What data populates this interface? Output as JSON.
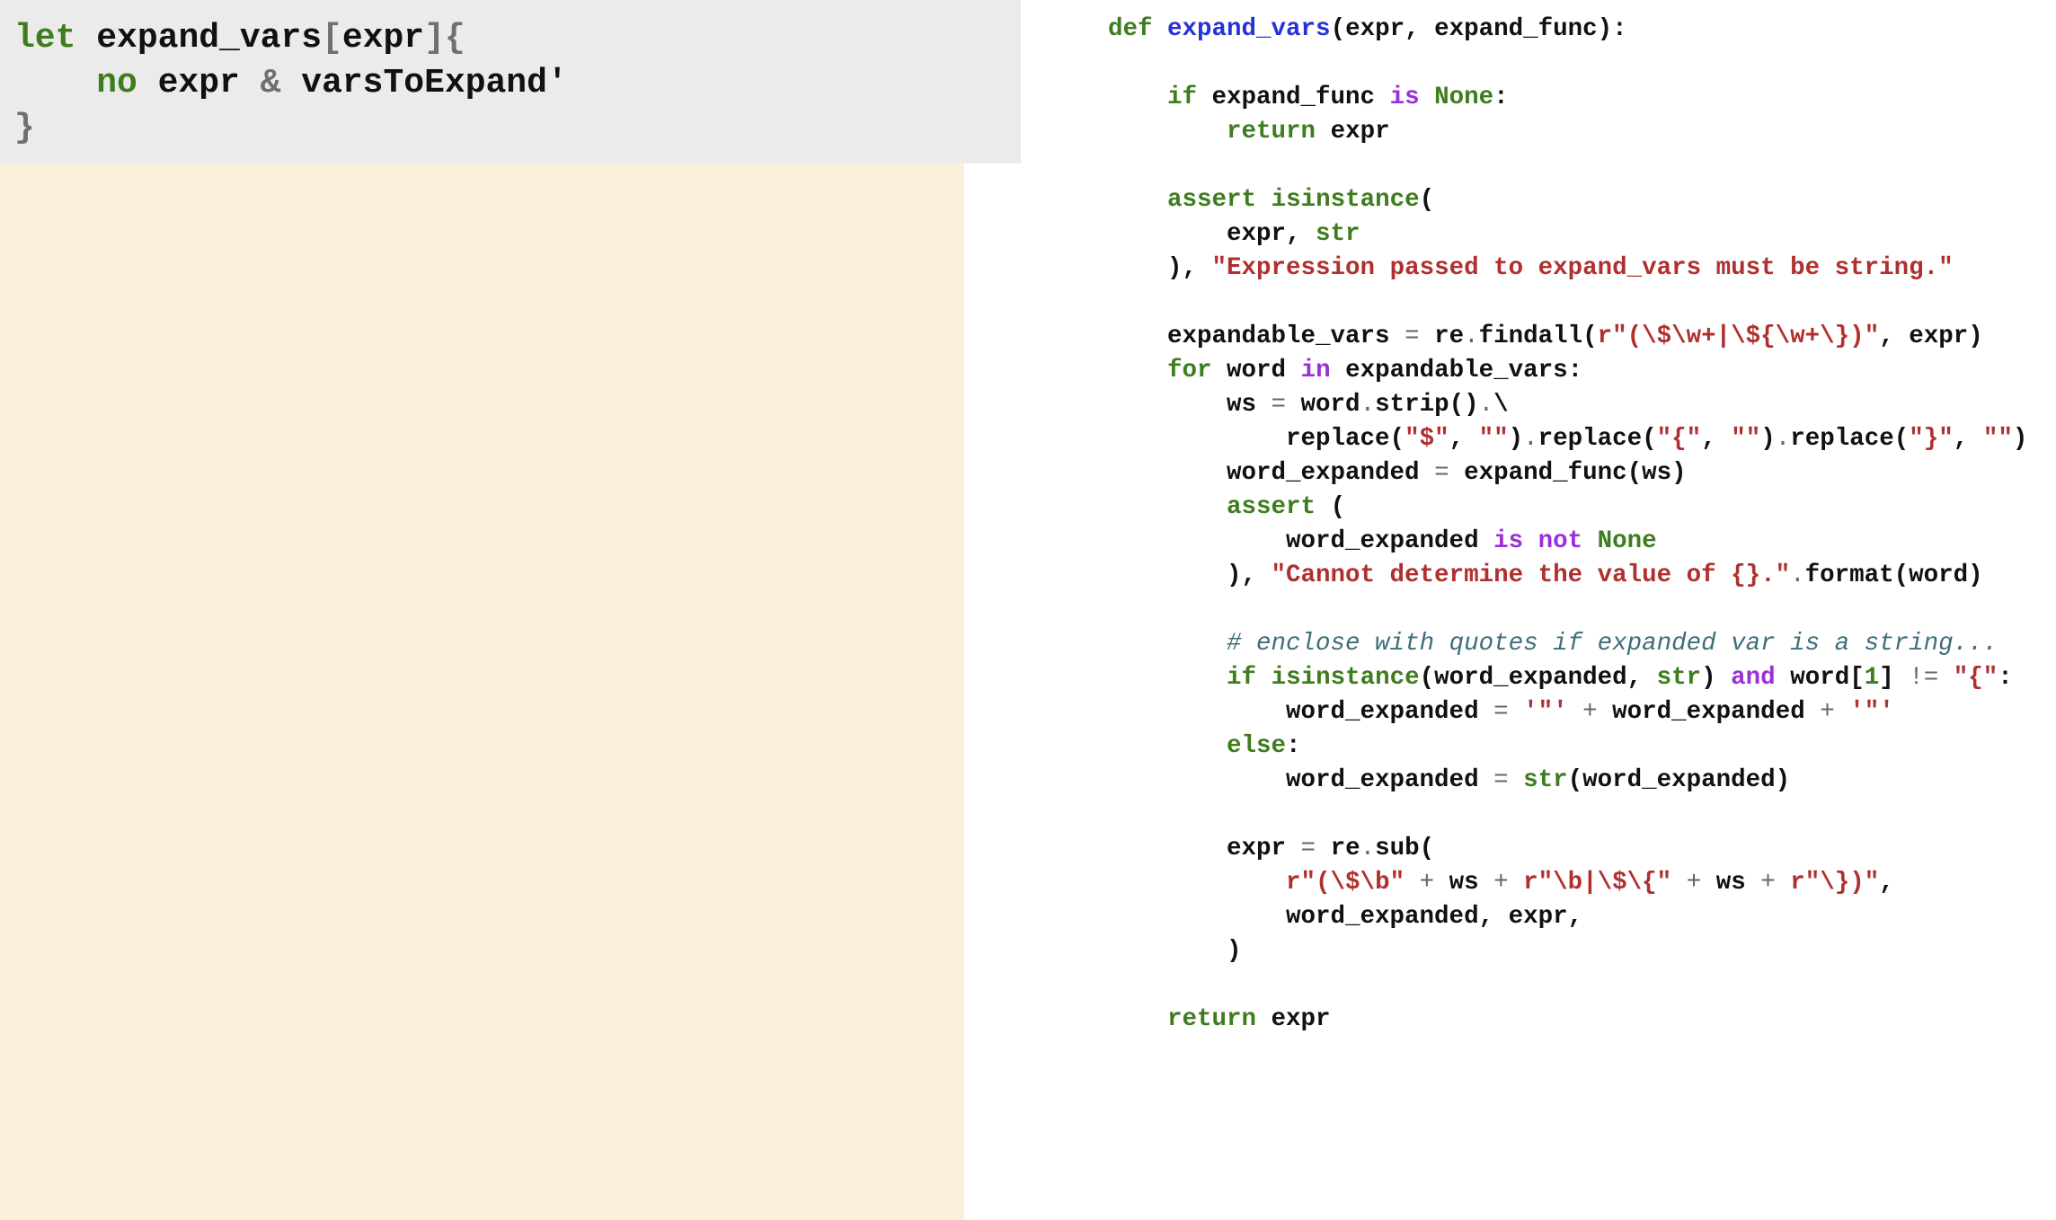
{
  "left_code": {
    "lines": [
      [
        {
          "t": "let",
          "k": "lkw"
        },
        {
          "t": " ",
          "k": "lid"
        },
        {
          "t": "expand_vars",
          "k": "lid"
        },
        {
          "t": "[",
          "k": "lsym"
        },
        {
          "t": "expr",
          "k": "lid"
        },
        {
          "t": "]{",
          "k": "lsym"
        }
      ],
      [
        {
          "t": "    ",
          "k": "lid"
        },
        {
          "t": "no",
          "k": "lkw"
        },
        {
          "t": " expr ",
          "k": "lid"
        },
        {
          "t": "&",
          "k": "lsym"
        },
        {
          "t": " varsToExpand'",
          "k": "lid"
        }
      ],
      [
        {
          "t": "}",
          "k": "lsym"
        }
      ]
    ]
  },
  "right_code": {
    "lines": [
      [
        {
          "t": "def",
          "k": "kw"
        },
        {
          "t": " ",
          "k": "id"
        },
        {
          "t": "expand_vars",
          "k": "def"
        },
        {
          "t": "(expr, expand_func):",
          "k": "id"
        }
      ],
      [],
      [
        {
          "t": "    ",
          "k": "id"
        },
        {
          "t": "if",
          "k": "kw"
        },
        {
          "t": " expand_func ",
          "k": "id"
        },
        {
          "t": "is",
          "k": "op2"
        },
        {
          "t": " ",
          "k": "id"
        },
        {
          "t": "None",
          "k": "kw"
        },
        {
          "t": ":",
          "k": "id"
        }
      ],
      [
        {
          "t": "        ",
          "k": "id"
        },
        {
          "t": "return",
          "k": "kw"
        },
        {
          "t": " expr",
          "k": "id"
        }
      ],
      [],
      [
        {
          "t": "    ",
          "k": "id"
        },
        {
          "t": "assert",
          "k": "kw"
        },
        {
          "t": " ",
          "k": "id"
        },
        {
          "t": "isinstance",
          "k": "kw"
        },
        {
          "t": "(",
          "k": "id"
        }
      ],
      [
        {
          "t": "        expr, ",
          "k": "id"
        },
        {
          "t": "str",
          "k": "kw"
        }
      ],
      [
        {
          "t": "    ), ",
          "k": "id"
        },
        {
          "t": "\"Expression passed to expand_vars must be string.\"",
          "k": "str"
        }
      ],
      [],
      [
        {
          "t": "    expandable_vars ",
          "k": "id"
        },
        {
          "t": "=",
          "k": "sym"
        },
        {
          "t": " re",
          "k": "id"
        },
        {
          "t": ".",
          "k": "sym"
        },
        {
          "t": "findall(",
          "k": "id"
        },
        {
          "t": "r\"(\\$\\w+|\\${\\w+\\})\"",
          "k": "str"
        },
        {
          "t": ", expr)",
          "k": "id"
        }
      ],
      [
        {
          "t": "    ",
          "k": "id"
        },
        {
          "t": "for",
          "k": "kw"
        },
        {
          "t": " word ",
          "k": "id"
        },
        {
          "t": "in",
          "k": "op2"
        },
        {
          "t": " expandable_vars:",
          "k": "id"
        }
      ],
      [
        {
          "t": "        ws ",
          "k": "id"
        },
        {
          "t": "=",
          "k": "sym"
        },
        {
          "t": " word",
          "k": "id"
        },
        {
          "t": ".",
          "k": "sym"
        },
        {
          "t": "strip()",
          "k": "id"
        },
        {
          "t": ".",
          "k": "sym"
        },
        {
          "t": "\\",
          "k": "id"
        }
      ],
      [
        {
          "t": "            replace(",
          "k": "id"
        },
        {
          "t": "\"$\"",
          "k": "str"
        },
        {
          "t": ", ",
          "k": "id"
        },
        {
          "t": "\"\"",
          "k": "str"
        },
        {
          "t": ")",
          "k": "id"
        },
        {
          "t": ".",
          "k": "sym"
        },
        {
          "t": "replace(",
          "k": "id"
        },
        {
          "t": "\"{\"",
          "k": "str"
        },
        {
          "t": ", ",
          "k": "id"
        },
        {
          "t": "\"\"",
          "k": "str"
        },
        {
          "t": ")",
          "k": "id"
        },
        {
          "t": ".",
          "k": "sym"
        },
        {
          "t": "replace(",
          "k": "id"
        },
        {
          "t": "\"}\"",
          "k": "str"
        },
        {
          "t": ", ",
          "k": "id"
        },
        {
          "t": "\"\"",
          "k": "str"
        },
        {
          "t": ")",
          "k": "id"
        }
      ],
      [
        {
          "t": "        word_expanded ",
          "k": "id"
        },
        {
          "t": "=",
          "k": "sym"
        },
        {
          "t": " expand_func(ws)",
          "k": "id"
        }
      ],
      [
        {
          "t": "        ",
          "k": "id"
        },
        {
          "t": "assert",
          "k": "kw"
        },
        {
          "t": " (",
          "k": "id"
        }
      ],
      [
        {
          "t": "            word_expanded ",
          "k": "id"
        },
        {
          "t": "is",
          "k": "op2"
        },
        {
          "t": " ",
          "k": "id"
        },
        {
          "t": "not",
          "k": "op2"
        },
        {
          "t": " ",
          "k": "id"
        },
        {
          "t": "None",
          "k": "kw"
        }
      ],
      [
        {
          "t": "        ), ",
          "k": "id"
        },
        {
          "t": "\"Cannot determine the value of {}.\"",
          "k": "str"
        },
        {
          "t": ".",
          "k": "sym"
        },
        {
          "t": "format(word)",
          "k": "id"
        }
      ],
      [],
      [
        {
          "t": "        ",
          "k": "id"
        },
        {
          "t": "# enclose with quotes if expanded var is a string...",
          "k": "com"
        }
      ],
      [
        {
          "t": "        ",
          "k": "id"
        },
        {
          "t": "if",
          "k": "kw"
        },
        {
          "t": " ",
          "k": "id"
        },
        {
          "t": "isinstance",
          "k": "kw"
        },
        {
          "t": "(word_expanded, ",
          "k": "id"
        },
        {
          "t": "str",
          "k": "kw"
        },
        {
          "t": ") ",
          "k": "id"
        },
        {
          "t": "and",
          "k": "op2"
        },
        {
          "t": " word[",
          "k": "id"
        },
        {
          "t": "1",
          "k": "num"
        },
        {
          "t": "] ",
          "k": "id"
        },
        {
          "t": "!=",
          "k": "sym"
        },
        {
          "t": " ",
          "k": "id"
        },
        {
          "t": "\"{\"",
          "k": "str"
        },
        {
          "t": ":",
          "k": "id"
        }
      ],
      [
        {
          "t": "            word_expanded ",
          "k": "id"
        },
        {
          "t": "=",
          "k": "sym"
        },
        {
          "t": " ",
          "k": "id"
        },
        {
          "t": "'\"'",
          "k": "str"
        },
        {
          "t": " ",
          "k": "id"
        },
        {
          "t": "+",
          "k": "sym"
        },
        {
          "t": " word_expanded ",
          "k": "id"
        },
        {
          "t": "+",
          "k": "sym"
        },
        {
          "t": " ",
          "k": "id"
        },
        {
          "t": "'\"'",
          "k": "str"
        }
      ],
      [
        {
          "t": "        ",
          "k": "id"
        },
        {
          "t": "else",
          "k": "kw"
        },
        {
          "t": ":",
          "k": "id"
        }
      ],
      [
        {
          "t": "            word_expanded ",
          "k": "id"
        },
        {
          "t": "=",
          "k": "sym"
        },
        {
          "t": " ",
          "k": "id"
        },
        {
          "t": "str",
          "k": "kw"
        },
        {
          "t": "(word_expanded)",
          "k": "id"
        }
      ],
      [],
      [
        {
          "t": "        expr ",
          "k": "id"
        },
        {
          "t": "=",
          "k": "sym"
        },
        {
          "t": " re",
          "k": "id"
        },
        {
          "t": ".",
          "k": "sym"
        },
        {
          "t": "sub(",
          "k": "id"
        }
      ],
      [
        {
          "t": "            ",
          "k": "id"
        },
        {
          "t": "r\"(\\$\\b\"",
          "k": "str"
        },
        {
          "t": " ",
          "k": "id"
        },
        {
          "t": "+",
          "k": "sym"
        },
        {
          "t": " ws ",
          "k": "id"
        },
        {
          "t": "+",
          "k": "sym"
        },
        {
          "t": " ",
          "k": "id"
        },
        {
          "t": "r\"\\b|\\$\\{\"",
          "k": "str"
        },
        {
          "t": " ",
          "k": "id"
        },
        {
          "t": "+",
          "k": "sym"
        },
        {
          "t": " ws ",
          "k": "id"
        },
        {
          "t": "+",
          "k": "sym"
        },
        {
          "t": " ",
          "k": "id"
        },
        {
          "t": "r\"\\})\"",
          "k": "str"
        },
        {
          "t": ",",
          "k": "id"
        }
      ],
      [
        {
          "t": "            word_expanded, expr,",
          "k": "id"
        }
      ],
      [
        {
          "t": "        )",
          "k": "id"
        }
      ],
      [],
      [
        {
          "t": "    ",
          "k": "id"
        },
        {
          "t": "return",
          "k": "kw"
        },
        {
          "t": " expr",
          "k": "id"
        }
      ]
    ]
  }
}
